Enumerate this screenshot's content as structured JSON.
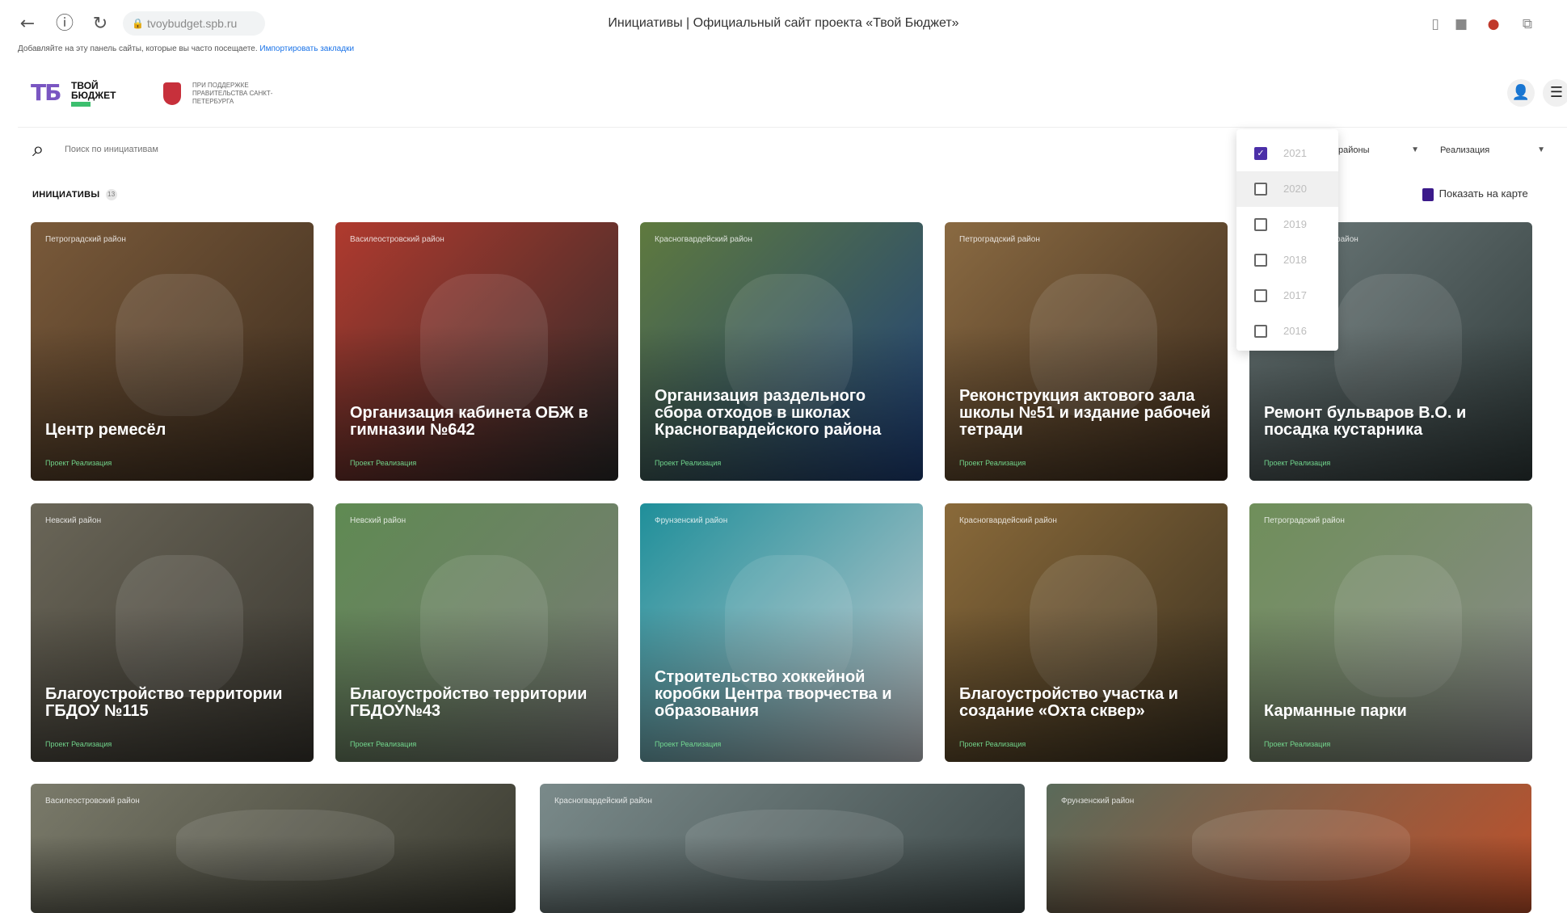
{
  "browser": {
    "url": "tvoybudget.spb.ru",
    "title": "Инициативы | Официальный сайт проекта «Твой Бюджет»",
    "bookmark_hint": "Добавляйте на эту панель сайты, которые вы часто посещаете.",
    "bookmark_link": "Импортировать закладки"
  },
  "header": {
    "logo_mark": "ТБ",
    "logo_line1": "ТВОЙ",
    "logo_line2": "БЮДЖЕТ",
    "gov_text": "ПРИ ПОДДЕРЖКЕ ПРАВИТЕЛЬСТВА САНКТ-ПЕТЕРБУРГА"
  },
  "filters": {
    "search_placeholder": "Поиск по инициативам",
    "districts_label": "районы",
    "status_label": "Реализация",
    "years": [
      {
        "label": "2021",
        "checked": true
      },
      {
        "label": "2020",
        "checked": false
      },
      {
        "label": "2019",
        "checked": false
      },
      {
        "label": "2018",
        "checked": false
      },
      {
        "label": "2017",
        "checked": false
      },
      {
        "label": "2016",
        "checked": false
      }
    ]
  },
  "section": {
    "title": "ИНИЦИАТИВЫ",
    "count": "13",
    "map_link": "Показать на карте"
  },
  "cards": [
    {
      "district": "Петроградский район",
      "title": "Центр ремесёл",
      "tag": "Проект Реализация",
      "colors": [
        "#7a5a3a",
        "#3c2c1e"
      ]
    },
    {
      "district": "Василеостровский район",
      "title": "Организация кабинета ОБЖ в гимназии №642",
      "tag": "Проект Реализация",
      "colors": [
        "#b03a2e",
        "#2a2a2a"
      ]
    },
    {
      "district": "Красногвардейский район",
      "title": "Организация раздельного сбора отходов в школах Красногвардейского района",
      "tag": "Проект Реализация",
      "colors": [
        "#5f7a3e",
        "#1d3f7a"
      ]
    },
    {
      "district": "Петроградский район",
      "title": "Реконструкция актового зала школы №51 и издание рабочей тетради",
      "tag": "Проект Реализация",
      "colors": [
        "#8a6a42",
        "#3a2a1c"
      ]
    },
    {
      "district": "Василеостровский район",
      "title": "Ремонт бульваров В.О. и посадка кустарника",
      "tag": "Проект Реализация",
      "colors": [
        "#6d7a7a",
        "#2f3a3a"
      ]
    },
    {
      "district": "Невский район",
      "title": "Благоустройство территории ГБДОУ №115",
      "tag": "Проект Реализация",
      "colors": [
        "#6a6658",
        "#3a3730"
      ]
    },
    {
      "district": "Невский район",
      "title": "Благоустройство территории ГБДОУ№43",
      "tag": "Проект Реализация",
      "colors": [
        "#5f8a52",
        "#7a7a78"
      ]
    },
    {
      "district": "Фрунзенский район",
      "title": "Строительство хоккейной коробки Центра творчества и образования",
      "tag": "Проект Реализация",
      "colors": [
        "#1f8f9a",
        "#c9cdd2"
      ]
    },
    {
      "district": "Красногвардейский район",
      "title": "Благоустройство участка и создание «Охта сквер»",
      "tag": "Проект Реализация",
      "colors": [
        "#8a6a3a",
        "#3a3020"
      ]
    },
    {
      "district": "Петроградский район",
      "title": "Карманные парки",
      "tag": "Проект Реализация",
      "colors": [
        "#6f8f5a",
        "#8a8a8a"
      ]
    },
    {
      "district": "Василеостровский район",
      "title": "",
      "tag": "",
      "colors": [
        "#7a7a6a",
        "#3a3a30"
      ]
    },
    {
      "district": "Красногвардейский район",
      "title": "",
      "tag": "",
      "colors": [
        "#7a8a8a",
        "#3f4a4a"
      ]
    },
    {
      "district": "Фрунзенский район",
      "title": "",
      "tag": "",
      "colors": [
        "#5a6a5a",
        "#c0502a"
      ]
    }
  ]
}
